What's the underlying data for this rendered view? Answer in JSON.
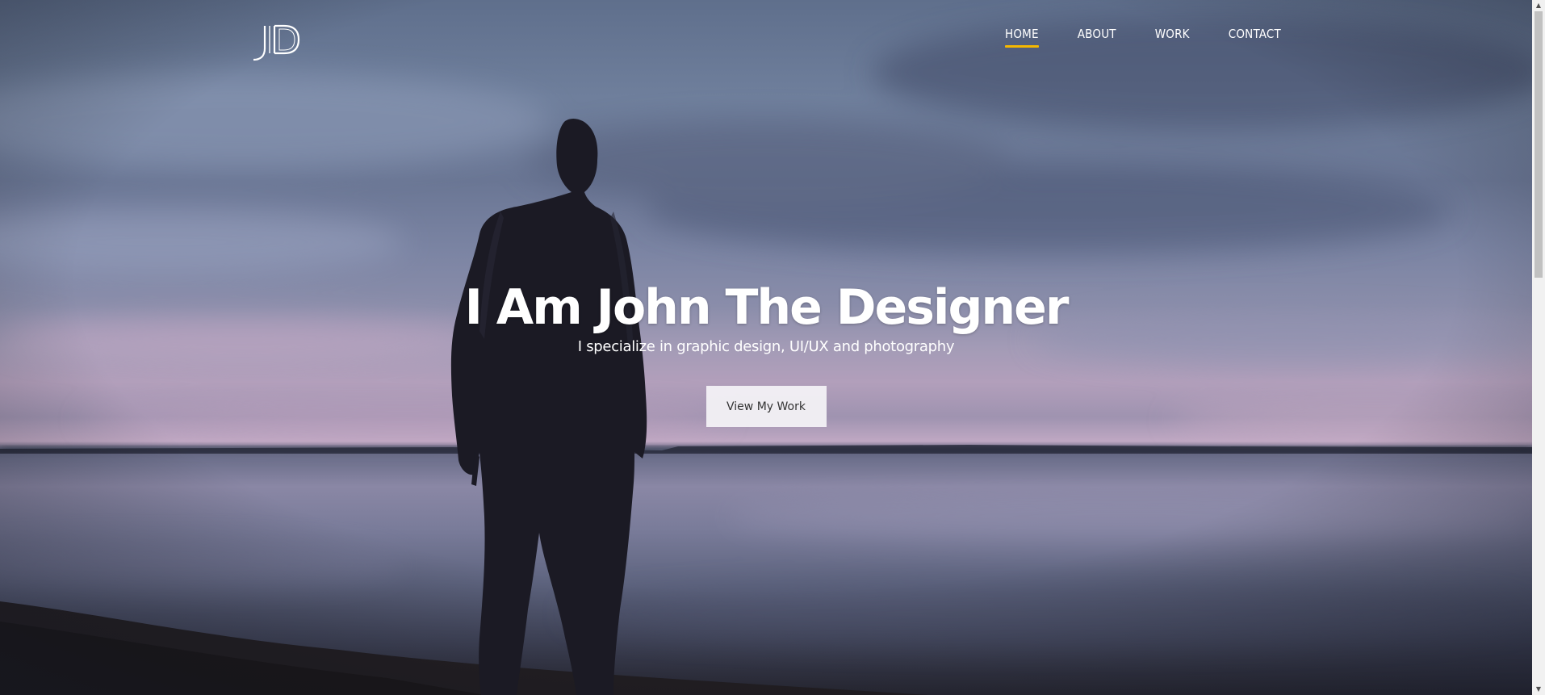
{
  "logo": {
    "text": "JD",
    "icon": "monogram-logo-icon"
  },
  "nav": {
    "items": [
      {
        "label": "HOME",
        "active": true
      },
      {
        "label": "ABOUT",
        "active": false
      },
      {
        "label": "WORK",
        "active": false
      },
      {
        "label": "CONTACT",
        "active": false
      }
    ],
    "active_color": "#f5b800"
  },
  "hero": {
    "title": "I Am John The Designer",
    "subtitle": "I specialize in graphic design, UI/UX and photography",
    "cta_label": "View My Work"
  }
}
